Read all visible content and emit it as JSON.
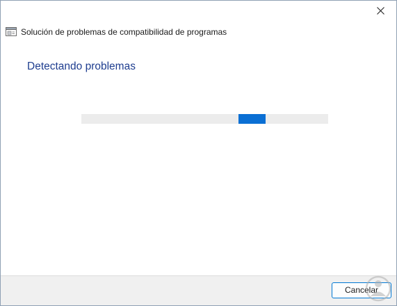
{
  "window": {
    "title": "Solución de problemas de compatibilidad de programas",
    "close_icon": "close-icon",
    "app_icon": "troubleshooter-icon"
  },
  "main": {
    "heading": "Detectando problemas",
    "progress": {
      "state": "indeterminate",
      "color": "#0a6fd4"
    }
  },
  "footer": {
    "cancel_label": "Cancelar"
  },
  "colors": {
    "heading": "#1e3d8f",
    "accent": "#0078d4"
  }
}
